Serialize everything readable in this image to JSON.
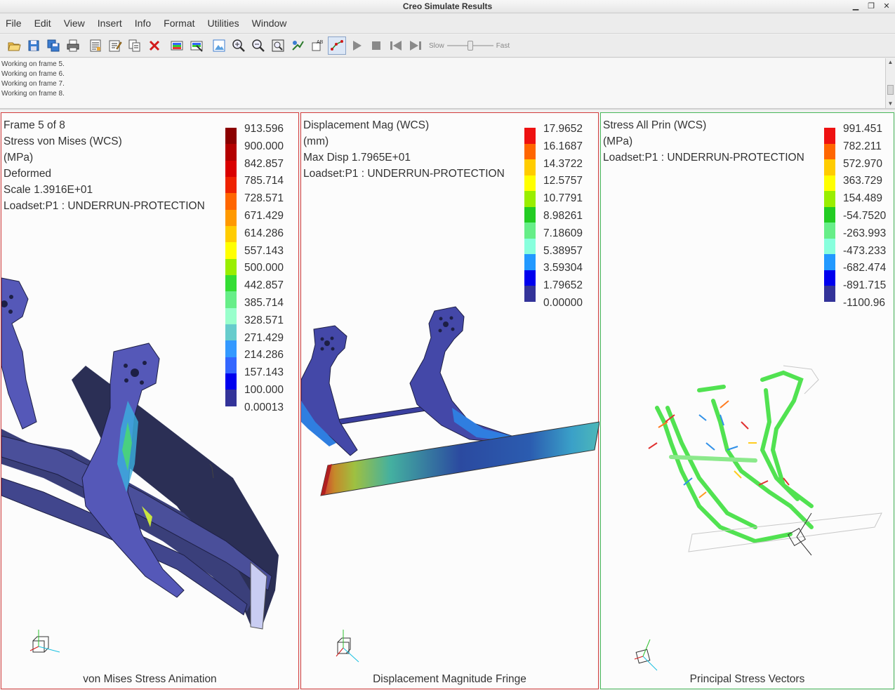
{
  "window": {
    "title": "Creo Simulate Results",
    "minimize": "▁",
    "restore": "❐",
    "close": "✕"
  },
  "menu": [
    "File",
    "Edit",
    "View",
    "Insert",
    "Info",
    "Format",
    "Utilities",
    "Window"
  ],
  "toolbar": {
    "icons": [
      "open-icon",
      "save-icon",
      "save-all-icon",
      "print-icon",
      "properties-icon",
      "edit-icon",
      "copy-icon",
      "delete-icon",
      "show-icon",
      "hide-icon",
      "view-icon",
      "zoom-in-icon",
      "zoom-out-icon",
      "refit-icon",
      "spin-icon",
      "annotate-icon",
      "query-icon"
    ],
    "playback": [
      "play-icon",
      "stop-icon",
      "rewind-icon",
      "forward-icon"
    ],
    "slow_label": "Slow",
    "fast_label": "Fast",
    "speed_level": 0.5
  },
  "messages": [
    "Working on frame 5.",
    "Working on frame 6.",
    "Working on frame 7.",
    "Working on frame 8."
  ],
  "panels": [
    {
      "info": [
        "Frame 5 of 8",
        "Stress von Mises (WCS)",
        "(MPa)",
        "Deformed",
        "Scale  1.3916E+01",
        "Loadset:P1 :  UNDERRUN-PROTECTION"
      ],
      "legend_values": [
        "913.596",
        "900.000",
        "842.857",
        "785.714",
        "728.571",
        "671.429",
        "614.286",
        "557.143",
        "500.000",
        "442.857",
        "385.714",
        "328.571",
        "271.429",
        "214.286",
        "157.143",
        "100.000",
        "0.00013"
      ],
      "legend_colors": [
        "#8b0000",
        "#b30000",
        "#d90000",
        "#ee2200",
        "#ff6600",
        "#ff9900",
        "#ffcc00",
        "#ffff00",
        "#99ee00",
        "#33dd33",
        "#66ee88",
        "#99ffcc",
        "#66cccc",
        "#3399ff",
        "#3366ff",
        "#0000ee",
        "#333399"
      ],
      "caption": "von Mises Stress Animation"
    },
    {
      "info": [
        "Displacement Mag (WCS)",
        "(mm)",
        "Max Disp  1.7965E+01",
        "Loadset:P1 :  UNDERRUN-PROTECTION"
      ],
      "legend_values": [
        "17.9652",
        "16.1687",
        "14.3722",
        "12.5757",
        "10.7791",
        "8.98261",
        "7.18609",
        "5.38957",
        "3.59304",
        "1.79652",
        "0.00000"
      ],
      "legend_colors": [
        "#ee1111",
        "#ff6600",
        "#ffcc00",
        "#ffff00",
        "#99ee00",
        "#22cc22",
        "#66ee88",
        "#88ffdd",
        "#2299ff",
        "#0000ee",
        "#333399"
      ],
      "caption": "Displacement Magnitude Fringe"
    },
    {
      "info": [
        "Stress All Prin (WCS)",
        "(MPa)",
        "Loadset:P1 :  UNDERRUN-PROTECTION"
      ],
      "legend_values": [
        "991.451",
        "782.211",
        "572.970",
        "363.729",
        "154.489",
        "-54.7520",
        "-263.993",
        "-473.233",
        "-682.474",
        "-891.715",
        "-1100.96"
      ],
      "legend_colors": [
        "#ee1111",
        "#ff6600",
        "#ffcc00",
        "#ffff00",
        "#99ee00",
        "#22cc22",
        "#66ee88",
        "#88ffdd",
        "#2299ff",
        "#0000ee",
        "#333399"
      ],
      "caption": "Principal Stress Vectors"
    }
  ]
}
